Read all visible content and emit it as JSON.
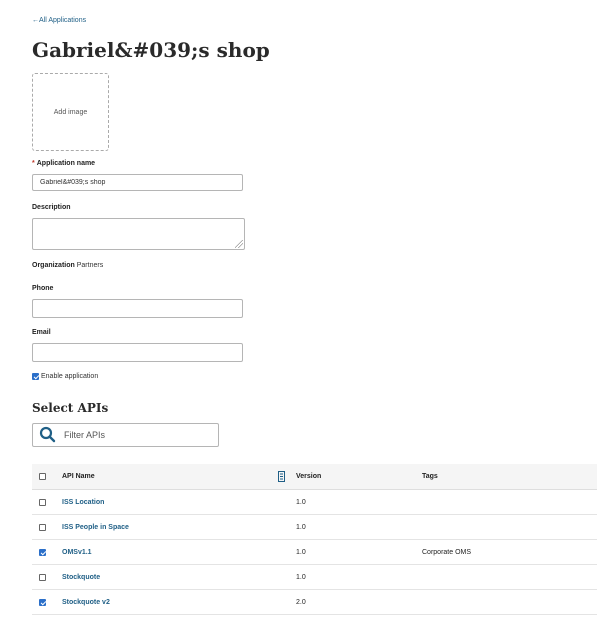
{
  "nav": {
    "back_label": "←All Applications"
  },
  "app": {
    "title": "Gabriel&#039;s shop"
  },
  "image_upload": {
    "label": "Add image"
  },
  "form": {
    "app_name_required_mark": "*",
    "app_name_label": "Application name",
    "app_name_value": "Gabriel&#039;s shop",
    "description_label": "Description",
    "organization_label": "Organization",
    "organization_value": "Partners",
    "phone_label": "Phone",
    "phone_value": "",
    "email_label": "Email",
    "email_value": "",
    "enable_label": "Enable application",
    "enable_checked": true
  },
  "apis": {
    "section_title": "Select APIs",
    "filter_placeholder": "Filter APIs",
    "columns": {
      "name": "API Name",
      "version": "Version",
      "tags": "Tags"
    },
    "rows": [
      {
        "name": "ISS Location",
        "version": "1.0",
        "tags": "",
        "checked": false
      },
      {
        "name": "ISS People in Space",
        "version": "1.0",
        "tags": "",
        "checked": false
      },
      {
        "name": "OMSv1.1",
        "version": "1.0",
        "tags": "Corporate OMS",
        "checked": true
      },
      {
        "name": "Stockquote",
        "version": "1.0",
        "tags": "",
        "checked": false
      },
      {
        "name": "Stockquote v2",
        "version": "2.0",
        "tags": "",
        "checked": true
      }
    ]
  },
  "colors": {
    "link": "#1f5f86",
    "checkbox_checked": "#2b6fc9",
    "required": "#c0392b"
  }
}
